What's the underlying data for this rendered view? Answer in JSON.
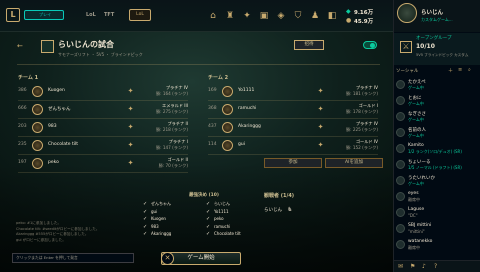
{
  "topbar": {
    "play_label": "プレイ",
    "tabs": [
      "LoL",
      "TFT"
    ],
    "active_tab": "LoL",
    "icons": [
      {
        "name": "home-icon"
      },
      {
        "name": "trophy-icon"
      },
      {
        "name": "loot-icon"
      },
      {
        "name": "collection-icon"
      },
      {
        "name": "loot-chest-icon"
      },
      {
        "name": "shop-icon"
      },
      {
        "name": "profile-icon"
      },
      {
        "name": "inventory-icon"
      }
    ],
    "icon_labels": [
      "",
      "",
      "",
      "",
      "",
      "",
      "",
      ""
    ],
    "currency_be": "9.16万",
    "currency_rp": "45.9万"
  },
  "lobby": {
    "title": "らいじんの試合",
    "subtitle": "サモナーズリフト ・ 5V5 ・ ブラインドピック",
    "invite_label": "招待",
    "team1_label": "チーム 1",
    "team2_label": "チーム 2",
    "team1": [
      {
        "level": "386",
        "name": "Kuogen",
        "rank": "プラチナ IV",
        "lp": "勝: 164 (ランク)"
      },
      {
        "level": "666",
        "name": "ぜんちゃん",
        "rank": "エメラルド III",
        "lp": "勝: 275 (ランク)"
      },
      {
        "level": "203",
        "name": "983",
        "rank": "プラチナ II",
        "lp": "勝: 218 (ランク)"
      },
      {
        "level": "235",
        "name": "Chocolate tilt",
        "rank": "プラチナ I",
        "lp": "勝: 147 (ランク)"
      },
      {
        "level": "197",
        "name": "peko",
        "rank": "ゴールド II",
        "lp": "勝: 70 (ランク)"
      }
    ],
    "team2": [
      {
        "level": "169",
        "name": "Yo1111",
        "rank": "プラチナ IV",
        "lp": "勝: 181 (ランク)"
      },
      {
        "level": "368",
        "name": "ramuchi",
        "rank": "ゴールド I",
        "lp": "勝: 178 (ランク)"
      },
      {
        "level": "437",
        "name": "Akaringgg",
        "rank": "プラチナ IV",
        "lp": "勝: 225 (ランク)"
      },
      {
        "level": "114",
        "name": "gui",
        "rank": "ゴールド IV",
        "lp": "勝: 152 (ランク)"
      }
    ],
    "join_label": "参加",
    "add_bot_label": "AIを追加",
    "bans_title": "最強決め (10)",
    "bans": [
      "ぜんちゃん",
      "らいじん",
      "gui",
      "Yo1111",
      "Kuogen",
      "peko",
      "983",
      "ramuchi",
      "Akaringgg",
      "Chocolate tilt"
    ],
    "spectators_label": "観戦者 (1/4)",
    "spectator_name": "らいじん",
    "start_label": "ゲーム開始",
    "chat_lines": [
      "peko: #1に参加しました。",
      "Chocolate tilt: #seeditがロビーに参加しました。",
      "Akaringgg #555がロビーに参加しました。",
      "gui がロビーに参加しました。"
    ],
    "chat_placeholder": "クリックまたは Enter を押して発言"
  },
  "social": {
    "user_name": "らいじん",
    "user_status": "カスタムゲーム...",
    "open_group_label": "オープングループ",
    "group_count": "10/10",
    "group_sub": "5V5 ブラインドピック カスタム",
    "section_label": "ソーシャル",
    "friends": [
      {
        "name": "たかえぺ",
        "status": "ゲーム中"
      },
      {
        "name": "とおに",
        "status": "ゲーム中"
      },
      {
        "name": "なぎささ",
        "status": "ゲーム中"
      },
      {
        "name": "名前の人",
        "status": "ゲーム中"
      },
      {
        "name": "Kamito",
        "status": "1/2 ランク(ソロ/デュオ) (SR)"
      },
      {
        "name": "ちょいーる",
        "status": "1/5 ノーマル (ドラフト) (SR)"
      },
      {
        "name": "うたいれいか",
        "status": "ゲーム中"
      },
      {
        "name": "eyes",
        "status": "離席中"
      },
      {
        "name": "Laguse",
        "status": "\"DC\""
      },
      {
        "name": "SBJ mittini",
        "status": "\"mittini\""
      },
      {
        "name": "watanekko",
        "status": "離席中"
      }
    ],
    "colors": {
      "accent": "#c8aa6e",
      "online": "#0acb9e"
    }
  }
}
